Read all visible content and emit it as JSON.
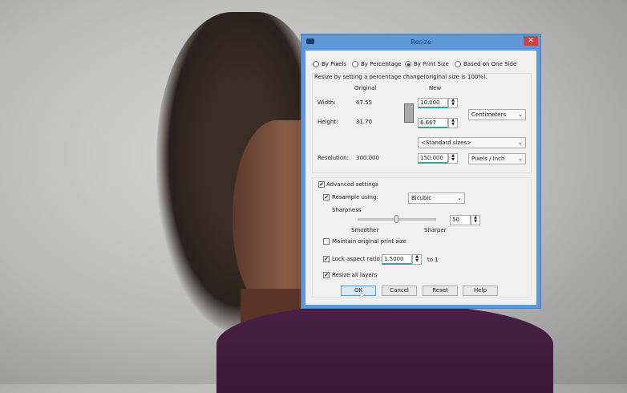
{
  "dialog": {
    "title": "Resize",
    "close": "✕"
  },
  "modes": [
    {
      "label": "By Pixels",
      "selected": false
    },
    {
      "label": "By Percentage",
      "selected": false
    },
    {
      "label": "By Print Size",
      "selected": true
    },
    {
      "label": "Based on One Side",
      "selected": false
    }
  ],
  "description": "Resize by setting a percentage change(original size is 100%).",
  "headers": {
    "original": "Original",
    "new": "New"
  },
  "width": {
    "label": "Width:",
    "original": "47.55",
    "new": "10.000"
  },
  "height": {
    "label": "Height:",
    "original": "31.70",
    "new": "6.667"
  },
  "units": "Centimeters",
  "standard_sizes": "<Standard sizes>",
  "resolution": {
    "label": "Resolution:",
    "original": "300.000",
    "new": "150.000",
    "units": "Pixels / Inch"
  },
  "advanced": {
    "label": "Advanced settings",
    "checked": true
  },
  "resample": {
    "label": "Resample using:",
    "checked": true,
    "method": "Bicubic"
  },
  "sharpness": {
    "label": "Sharpness",
    "min_label": "Smoother",
    "max_label": "Sharper",
    "value": "50",
    "percent": 50
  },
  "maintain": {
    "label": "Maintain original print size",
    "checked": false
  },
  "lock": {
    "label": "Lock aspect ratio:",
    "checked": true,
    "value": "1.5000",
    "suffix": "to 1"
  },
  "resize_layers": {
    "label": "Resize all layers",
    "checked": true
  },
  "buttons": {
    "ok": "OK",
    "cancel": "Cancel",
    "reset": "Reset",
    "help": "Help"
  },
  "check_glyph": "✔"
}
